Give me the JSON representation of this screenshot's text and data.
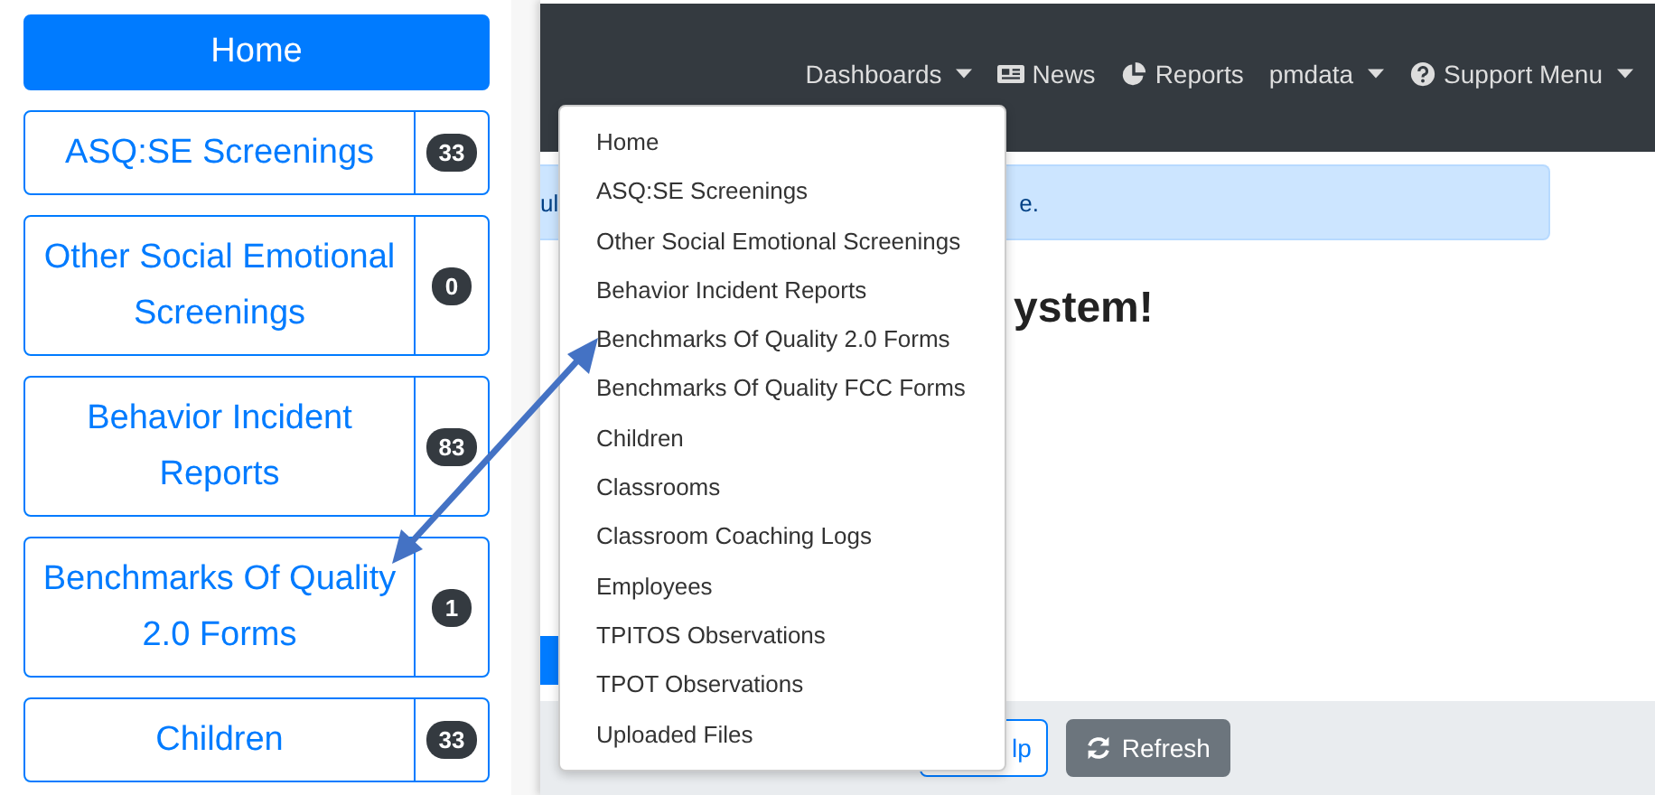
{
  "sidebar": {
    "items": [
      {
        "label": "Home",
        "selected": true
      },
      {
        "label": "ASQ:SE Screenings",
        "count": "33",
        "selected": false
      },
      {
        "label": "Other Social Emotional Screenings",
        "count": "0",
        "selected": false
      },
      {
        "label": "Behavior Incident Reports",
        "count": "83",
        "selected": false
      },
      {
        "label": "Benchmarks Of Quality 2.0 Forms",
        "count": "1",
        "selected": false
      },
      {
        "label": "Children",
        "count": "33",
        "selected": false
      }
    ]
  },
  "navbar": {
    "items": [
      {
        "label": "Dashboards",
        "kind": "menu"
      },
      {
        "label": "News",
        "kind": "link"
      },
      {
        "label": "Reports",
        "kind": "link"
      },
      {
        "label": "pmdata",
        "kind": "menu"
      },
      {
        "label": "Support Menu",
        "kind": "menu-with-icon"
      }
    ]
  },
  "dropdown": {
    "items": [
      "Home",
      "ASQ:SE Screenings",
      "Other Social Emotional Screenings",
      "Behavior Incident Reports",
      "Benchmarks Of Quality 2.0 Forms",
      "Benchmarks Of Quality FCC Forms",
      "Children",
      "Classrooms",
      "Classroom Coaching Logs",
      "Employees",
      "TPITOS Observations",
      "TPOT Observations",
      "Uploaded Files"
    ]
  },
  "alert": {
    "text_start": "ul",
    "text_end": "e."
  },
  "heading": "ystem!",
  "footer_buttons": [
    {
      "label": "lp",
      "kind": "outline"
    },
    {
      "label": "Refresh",
      "kind": "secondary"
    }
  ]
}
